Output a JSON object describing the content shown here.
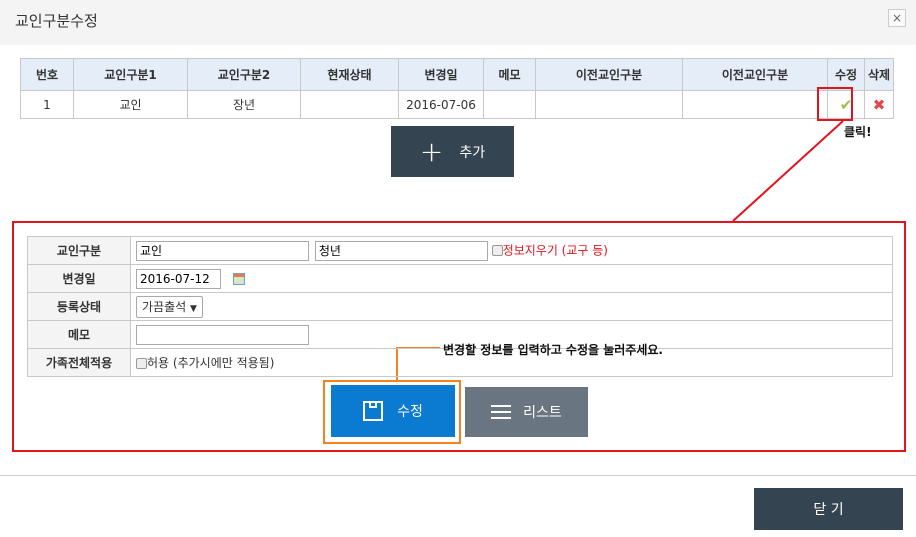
{
  "dialog": {
    "title": "교인구분수정",
    "close_icon": "×"
  },
  "list": {
    "headers": [
      "번호",
      "교인구분1",
      "교인구분2",
      "현재상태",
      "변경일",
      "메모",
      "이전교인구분",
      "이전교인구분",
      "수정",
      "삭제"
    ],
    "rows": [
      {
        "no": "1",
        "type1": "교인",
        "type2": "장년",
        "status": "",
        "date": "2016-07-06",
        "memo": "",
        "prev1": "",
        "prev2": ""
      }
    ]
  },
  "annotation_click": "클릭!",
  "add_button": "추가",
  "form": {
    "labels": [
      "교인구분",
      "변경일",
      "등록상태",
      "메모",
      "가족전체적용"
    ],
    "type1_value": "교인",
    "type2_value": "청년",
    "clear_info_label": "정보지우기 (교구 등)",
    "date_value": "2016-07-12",
    "status_value": "가끔출석",
    "memo_value": "",
    "family_apply_label": "허용 (추가시에만 적용됨)"
  },
  "annotation_instruction": "변경할 정보를 입력하고 수정을 눌러주세요.",
  "save_button": "수정",
  "list_button": "리스트",
  "close_button": "닫 기",
  "colors": {
    "annotation_red": "#e3141e",
    "annotation_orange": "#f48221",
    "primary": "#0b7ad1",
    "dark": "#354451"
  }
}
